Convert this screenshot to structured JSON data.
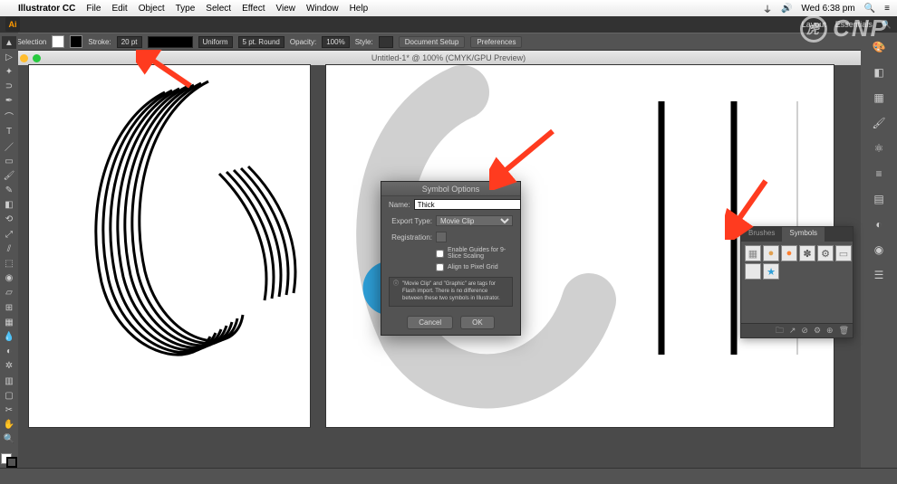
{
  "menubar": {
    "app": "Illustrator CC",
    "items": [
      "File",
      "Edit",
      "Object",
      "Type",
      "Select",
      "Effect",
      "View",
      "Window",
      "Help"
    ],
    "clock": "Wed 6:38 pm"
  },
  "appbar": {
    "right": [
      "Layout",
      "Essentials"
    ]
  },
  "optbar": {
    "label": "No Selection",
    "stroke": "Stroke:",
    "stroke_val": "20 pt",
    "uniform": "Uniform",
    "brush": "5 pt. Round",
    "opacity": "Opacity:",
    "opacity_val": "100%",
    "style": "Style:",
    "btn1": "Document Setup",
    "btn2": "Preferences"
  },
  "doc": {
    "title": "Untitled-1* @ 100% (CMYK/GPU Preview)"
  },
  "dialog": {
    "title": "Symbol Options",
    "name_lbl": "Name:",
    "name_val": "Thick",
    "type_lbl": "Export Type:",
    "type_val": "Movie Clip",
    "reg_lbl": "Registration:",
    "chk1": "Enable Guides for 9-Slice Scaling",
    "chk2": "Align to Pixel Grid",
    "info": "\"Movie Clip\" and \"Graphic\" are tags for Flash import. There is no difference between these two symbols in Illustrator.",
    "cancel": "Cancel",
    "ok": "OK"
  },
  "panel": {
    "tabs": [
      "Brushes",
      "Symbols"
    ],
    "symbols": [
      {
        "glyph": "▦",
        "color": "#888"
      },
      {
        "glyph": "●",
        "color": "#e0a050"
      },
      {
        "glyph": "●",
        "color": "#ff8030"
      },
      {
        "glyph": "✽",
        "color": "#555"
      },
      {
        "glyph": "⚙",
        "color": "#555"
      },
      {
        "glyph": "▭",
        "color": "#888"
      },
      {
        "glyph": "",
        "color": "#fff"
      },
      {
        "glyph": "★",
        "color": "#2e9fd8"
      }
    ]
  },
  "colors": {
    "accent": "#ff3b1f",
    "blue": "#2e9fd8"
  }
}
